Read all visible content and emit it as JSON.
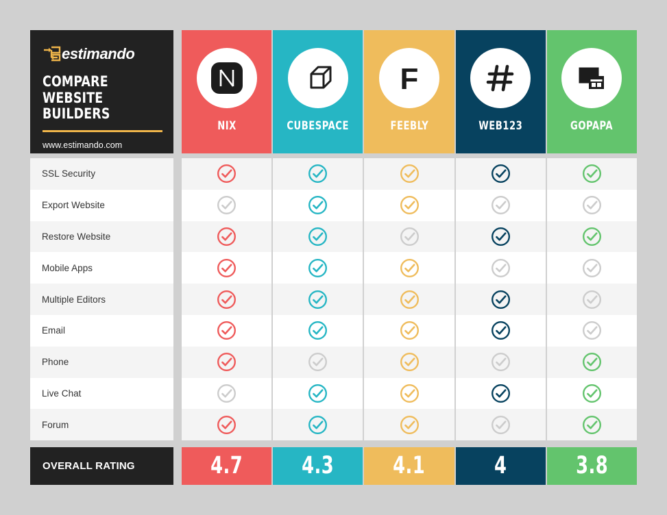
{
  "brand": {
    "mark_icon": "estimando-bracket-arrow-logo-icon",
    "wordmark": "estimando",
    "heading_line1": "COMPARE",
    "heading_line2": "WEBSITE BUILDERS",
    "url": "www.estimando.com",
    "accent_color": "#efb54a",
    "panel_color": "#222222"
  },
  "vendors": [
    {
      "name": "NIX",
      "icon": "nix-rounded-square-n-logo-icon",
      "color": "#ef5b5b",
      "rating": "4.7"
    },
    {
      "name": "CUBESPACE",
      "icon": "cubespace-3d-cube-outline-icon",
      "color": "#26b6c4",
      "rating": "4.3"
    },
    {
      "name": "FEEBLY",
      "icon": "feebly-letter-f-icon",
      "color": "#efbc5c",
      "rating": "4.1"
    },
    {
      "name": "WEB123",
      "icon": "web123-hash-icon",
      "color": "#07425f",
      "rating": "4"
    },
    {
      "name": "GOPAPA",
      "icon": "gopapa-browser-windows-icon",
      "color": "#63c46d",
      "rating": "3.8"
    }
  ],
  "features": [
    {
      "label": "SSL Security",
      "support": [
        true,
        true,
        true,
        true,
        true
      ]
    },
    {
      "label": "Export Website",
      "support": [
        false,
        true,
        true,
        false,
        false
      ]
    },
    {
      "label": "Restore Website",
      "support": [
        true,
        true,
        false,
        true,
        true
      ]
    },
    {
      "label": "Mobile Apps",
      "support": [
        true,
        true,
        true,
        false,
        false
      ]
    },
    {
      "label": "Multiple Editors",
      "support": [
        true,
        true,
        true,
        true,
        false
      ]
    },
    {
      "label": "Email",
      "support": [
        true,
        true,
        true,
        true,
        false
      ]
    },
    {
      "label": "Phone",
      "support": [
        true,
        false,
        true,
        false,
        true
      ]
    },
    {
      "label": "Live Chat",
      "support": [
        false,
        true,
        true,
        true,
        true
      ]
    },
    {
      "label": "Forum",
      "support": [
        true,
        true,
        true,
        false,
        true
      ]
    }
  ],
  "rating_row": {
    "label": "OVERALL RATING"
  },
  "colors": {
    "page_background": "#d0d0d0",
    "row_odd": "#f4f4f4",
    "row_even": "#ffffff",
    "inactive_check": "#cccccc",
    "feature_text": "#333333"
  }
}
